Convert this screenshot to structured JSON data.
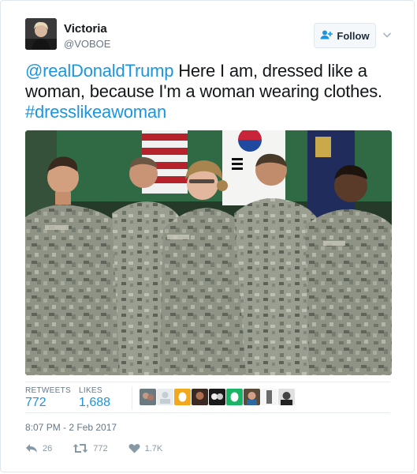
{
  "user": {
    "name": "Victoria",
    "handle": "@VOBOE"
  },
  "follow": {
    "label": "Follow"
  },
  "tweet": {
    "mention": "@realDonaldTrump",
    "body": " Here I am, dressed like a woman, because I'm a woman wearing clothes. ",
    "hashtag": "#dresslikeawoman"
  },
  "stats": {
    "retweets_label": "RETWEETS",
    "retweets_value": "772",
    "likes_label": "LIKES",
    "likes_value": "1,688"
  },
  "timestamp": "8:07 PM - 2 Feb 2017",
  "actions": {
    "reply_count": "26",
    "retweet_count": "772",
    "like_count": "1.7K"
  },
  "colors": {
    "link": "#1b95e0",
    "muted": "#657786",
    "action": "#8899a6"
  }
}
